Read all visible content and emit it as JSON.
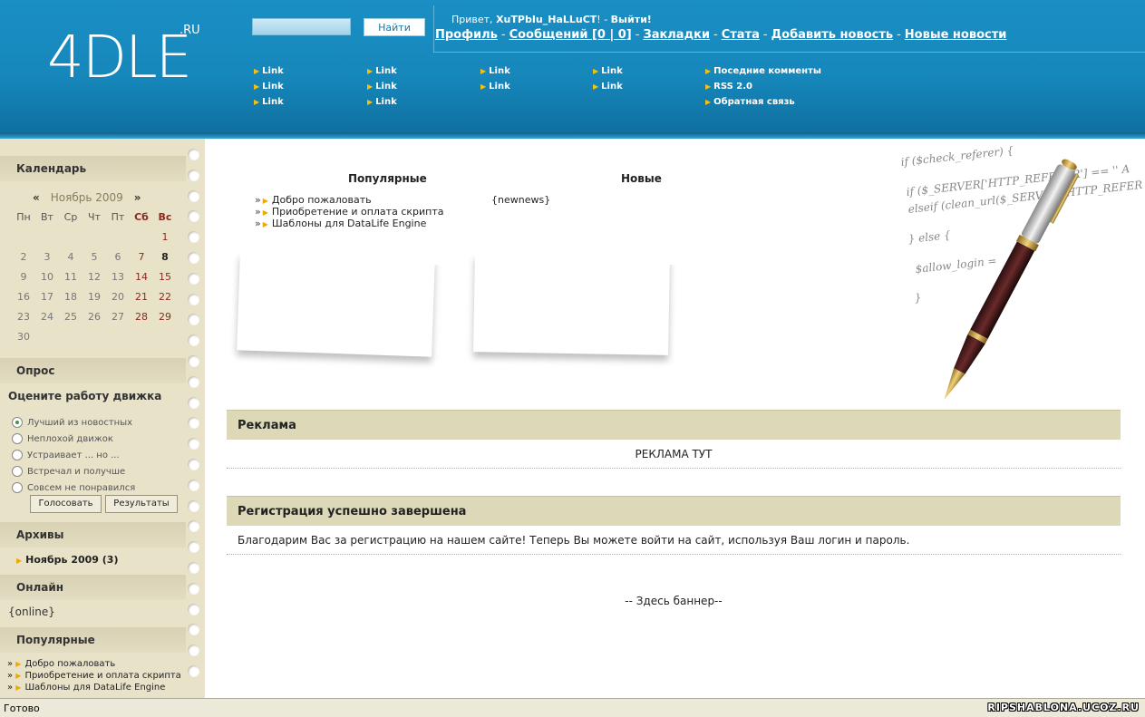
{
  "header": {
    "logo": "4DLE",
    "logo_suffix": ".RU",
    "search_button": "Найти",
    "greeting_prefix": "Привет, ",
    "username": "XuTPbIu_HaLLuCT",
    "greeting_suffix": "! - ",
    "logout": "Выйти!",
    "user_links": [
      "Профиль",
      "Сообщений [0 | 0]",
      "Закладки",
      "Стата",
      "Добавить новость",
      "Новые новости"
    ],
    "separator": "-",
    "nav_col1": [
      "Link",
      "Link",
      "Link"
    ],
    "nav_col2": [
      "Link",
      "Link",
      "Link"
    ],
    "nav_col3": [
      "Link",
      "Link"
    ],
    "nav_col4": [
      "Link",
      "Link"
    ],
    "nav_col5": [
      "Поседние комменты",
      "RSS 2.0",
      "Обратная связь"
    ]
  },
  "sidebar": {
    "calendar_title": "Календарь",
    "calendar_prev": "«",
    "calendar_month": "Ноябрь 2009",
    "calendar_next": "»",
    "weekdays": [
      "Пн",
      "Вт",
      "Ср",
      "Чт",
      "Пт",
      "Сб",
      "Вс"
    ],
    "weeks": [
      [
        "",
        "",
        "",
        "",
        "",
        "",
        "1"
      ],
      [
        "2",
        "3",
        "4",
        "5",
        "6",
        "7",
        "8"
      ],
      [
        "9",
        "10",
        "11",
        "12",
        "13",
        "14",
        "15"
      ],
      [
        "16",
        "17",
        "18",
        "19",
        "20",
        "21",
        "22"
      ],
      [
        "23",
        "24",
        "25",
        "26",
        "27",
        "28",
        "29"
      ],
      [
        "30",
        "",
        "",
        "",
        "",
        "",
        ""
      ]
    ],
    "poll_title": "Опрос",
    "poll_question": "Оцените работу движка",
    "poll_options": [
      "Лучший из новостных",
      "Неплохой движок",
      "Устраивает ... но ...",
      "Встречал и получше",
      "Совсем не понравился"
    ],
    "vote_button": "Голосовать",
    "results_button": "Результаты",
    "archives_title": "Архивы",
    "archive_item": "Ноябрь 2009 (3)",
    "online_title": "Онлайн",
    "online_text": "{online}",
    "popular_title": "Популярные",
    "popular_items": [
      "Добро пожаловать",
      "Приобретение и оплата скрипта",
      "Шаблоны для DataLife Engine"
    ]
  },
  "main": {
    "popular_title": "Популярные",
    "popular_items": [
      "Добро пожаловать",
      "Приобретение и оплата скрипта",
      "Шаблоны для DataLife Engine"
    ],
    "new_title": "Новые",
    "new_text": "{newnews}",
    "code_lines": [
      "if ($check_referer) {",
      "if ($_SERVER['HTTP_REFERER'] == '' A",
      "elseif (clean_url($_SERVER['HTTP_REFER",
      "} else {",
      "$allow_login =",
      "}"
    ],
    "ad_title": "Реклама",
    "ad_text": "РЕКЛАМА ТУТ",
    "reg_title": "Регистрация успешно завершена",
    "reg_text": "Благодарим Вас за регистрацию на нашем сайте! Теперь Вы можете войти на сайт, используя Ваш логин и пароль.",
    "banner_text": "-- Здесь баннер--"
  },
  "statusbar": {
    "status": "Готово",
    "watermark": "RIPSHABLONA.UCOZ.RU"
  }
}
